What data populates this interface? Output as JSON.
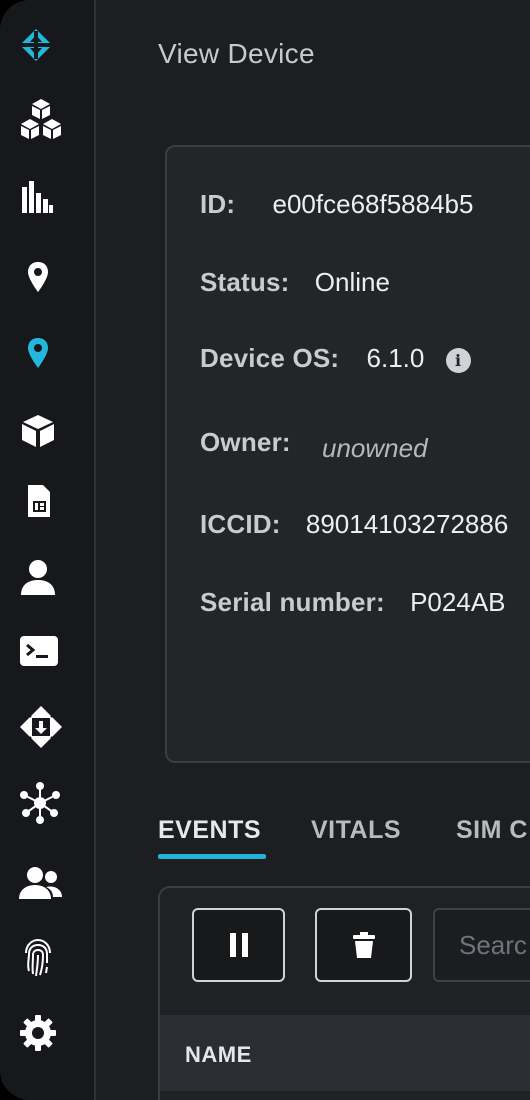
{
  "page": {
    "title": "View Device"
  },
  "sidebar": {
    "items": [
      {
        "icon": "brand-logo-icon",
        "active": true
      },
      {
        "icon": "products-cubes-icon"
      },
      {
        "icon": "bar-chart-icon"
      },
      {
        "icon": "location-pin-icon"
      },
      {
        "icon": "location-pin-active-icon",
        "active": true
      },
      {
        "icon": "cube-icon"
      },
      {
        "icon": "sim-card-icon"
      },
      {
        "icon": "user-icon"
      },
      {
        "icon": "terminal-icon"
      },
      {
        "icon": "chip-download-icon"
      },
      {
        "icon": "network-nodes-icon"
      },
      {
        "icon": "team-icon"
      },
      {
        "icon": "fingerprint-icon"
      },
      {
        "icon": "gear-icon"
      }
    ],
    "accent_color": "#1fb4d8"
  },
  "device": {
    "id_label": "ID:",
    "id_value": "e00fce68f5884b5",
    "status_label": "Status:",
    "status_value": "Online",
    "os_label": "Device OS:",
    "os_value": "6.1.0",
    "owner_label": "Owner:",
    "owner_value": "unowned",
    "iccid_label": "ICCID:",
    "iccid_value": "89014103272886",
    "serial_label": "Serial number:",
    "serial_value": "P024AB"
  },
  "tabs": [
    {
      "label": "EVENTS",
      "active": true
    },
    {
      "label": "VITALS"
    },
    {
      "label": "SIM C"
    }
  ],
  "events": {
    "pause_icon": "pause-icon",
    "delete_icon": "trash-icon",
    "search_placeholder": "Searc",
    "table_columns": [
      "NAME"
    ]
  }
}
